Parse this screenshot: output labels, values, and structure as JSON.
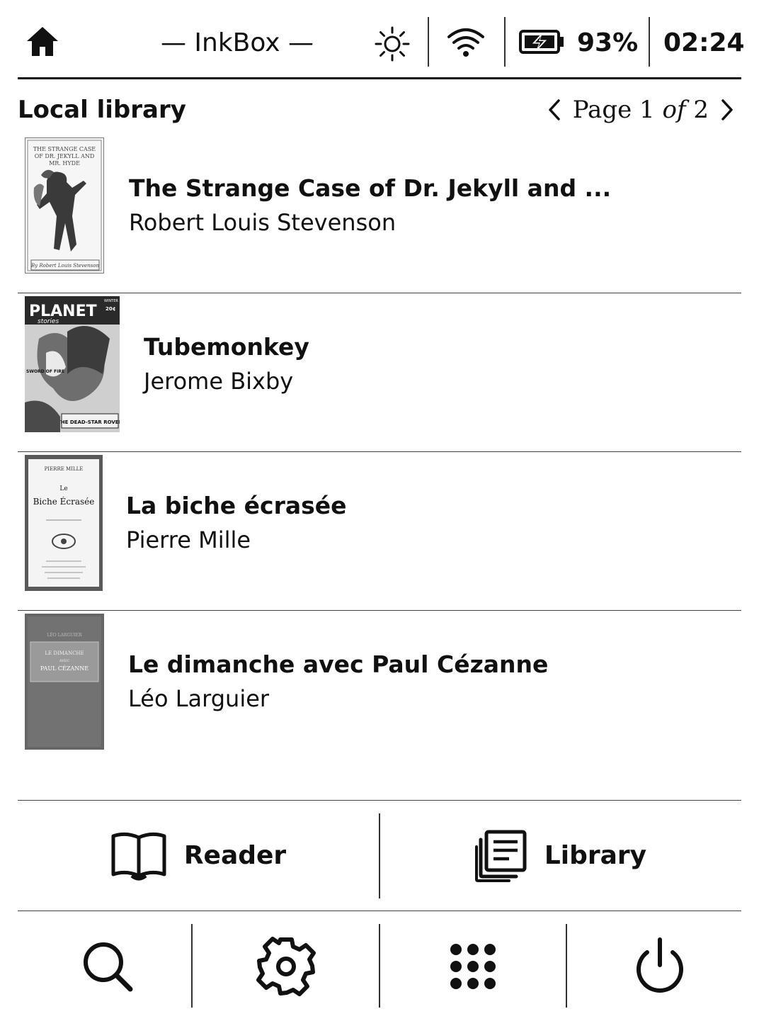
{
  "status_bar": {
    "home_icon": "home-icon",
    "title": "— InkBox —",
    "brightness_icon": "brightness-icon",
    "wifi_icon": "wifi-icon",
    "battery_icon": "battery-charging-icon",
    "battery_percent": "93%",
    "time": "02:24"
  },
  "library": {
    "heading": "Local library",
    "pager": {
      "prev_icon": "chevron-left-icon",
      "next_icon": "chevron-right-icon",
      "page_word": "Page",
      "current": "1",
      "of_word": "of",
      "total": "2"
    },
    "books": [
      {
        "title": "The Strange Case of Dr. Jekyll and ...",
        "author": "Robert Louis Stevenson",
        "cover_lines": [
          "THE STRANGE CASE",
          "OF DR. JEKYLL AND",
          "MR. HYDE"
        ],
        "cover_footer": "By Robert Louis Stevenson"
      },
      {
        "title": "Tubemonkey",
        "author": "Jerome Bixby",
        "cover_masthead": "PLANET",
        "cover_sub": "stories",
        "cover_season": "WINTER",
        "cover_price": "20¢",
        "cover_side": "SWORD OF FIRE",
        "cover_banner": "THE DEAD-STAR ROVER"
      },
      {
        "title": "La biche écrasée",
        "author": "Pierre Mille",
        "cover_author": "PIERRE MILLE",
        "cover_le": "Le",
        "cover_title": "Biche Écrasée"
      },
      {
        "title": "Le dimanche avec Paul Cézanne",
        "author": "Léo Larguier",
        "cover_author": "LÉO LARGUIER",
        "cover_line1": "LE DIMANCHE",
        "cover_line2": "AVEC",
        "cover_line3": "PAUL CÉZANNE"
      }
    ]
  },
  "actions": {
    "reader_label": "Reader",
    "reader_icon": "open-book-icon",
    "library_label": "Library",
    "library_icon": "library-stack-icon"
  },
  "tools": {
    "search_icon": "search-icon",
    "settings_icon": "gear-icon",
    "apps_icon": "apps-grid-icon",
    "power_icon": "power-icon"
  }
}
